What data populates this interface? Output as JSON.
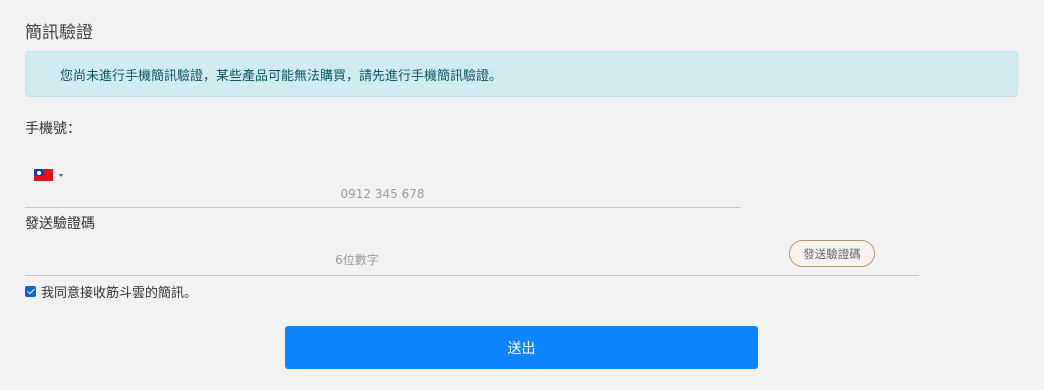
{
  "page": {
    "title": "簡訊驗證"
  },
  "alert": {
    "message": "您尚未進行手機簡訊驗證，某些產品可能無法購買，請先進行手機簡訊驗證。",
    "background_color": "#d1ecf1",
    "text_color": "#0c5460"
  },
  "phone": {
    "label": "手機號：",
    "country_flag_icon": "taiwan-flag-icon",
    "placeholder": "0912 345 678",
    "value": ""
  },
  "code": {
    "label": "發送驗證碼",
    "placeholder": "6位數字",
    "value": "",
    "send_button_label": "發送驗證碼"
  },
  "agreement": {
    "checked": true,
    "label": "我同意接收筋斗雲的簡訊。"
  },
  "submit": {
    "label": "送出",
    "color": "#0d85ff"
  }
}
